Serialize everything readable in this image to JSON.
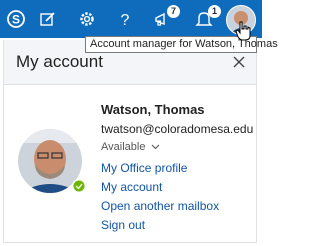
{
  "topbar": {
    "accent": "#0f6cbd",
    "icons": [
      "skype-icon",
      "edit-icon",
      "gear-icon",
      "help-icon",
      "megaphone-icon",
      "bell-icon"
    ],
    "megaphone_badge": "7",
    "bell_badge": "1"
  },
  "tooltip": "Account manager for Watson, Thomas",
  "panel": {
    "title": "My account",
    "close_icon": "close-icon"
  },
  "account": {
    "name": "Watson, Thomas",
    "email": "twatson@coloradomesa.edu",
    "status": "Available",
    "presence_color": "#6bb700",
    "links": [
      "My Office profile",
      "My account",
      "Open another mailbox",
      "Sign out"
    ]
  }
}
